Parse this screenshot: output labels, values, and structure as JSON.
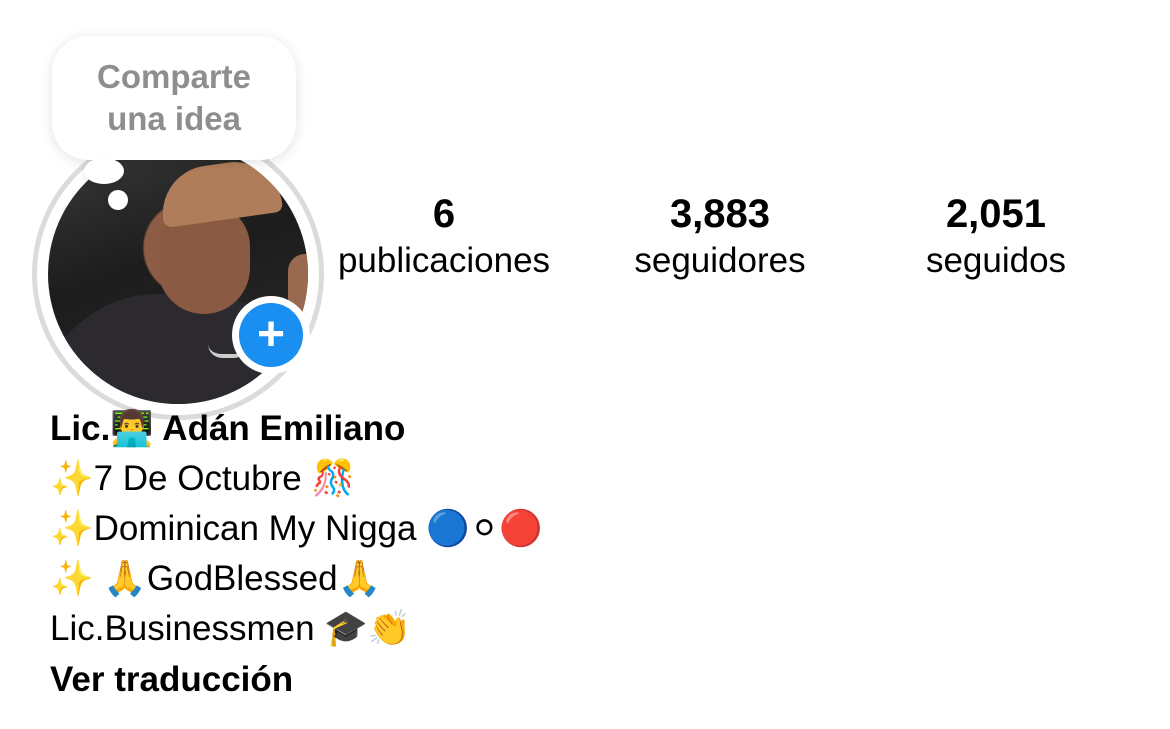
{
  "story_bubble": {
    "text": "Comparte una idea"
  },
  "profile": {
    "add_icon": "plus-icon",
    "avatar_icon": "profile-photo"
  },
  "stats": {
    "posts": {
      "value": "6",
      "label": "publicaciones"
    },
    "followers": {
      "value": "3,883",
      "label": "seguidores"
    },
    "following": {
      "value": "2,051",
      "label": "seguidos"
    }
  },
  "bio": {
    "name": "Lic.👨‍💻 Adán Emiliano",
    "lines": [
      "✨7 De Octubre 🎊",
      "✨Dominican My Nigga 🔵⚪🔴",
      "✨ 🙏GodBlessed🙏",
      "Lic.Businessmen 🎓👏"
    ],
    "translate": "Ver traducción"
  },
  "colors": {
    "accent": "#1a8ff2",
    "muted": "#8e8e8e",
    "ring": "#dbdbdb"
  }
}
